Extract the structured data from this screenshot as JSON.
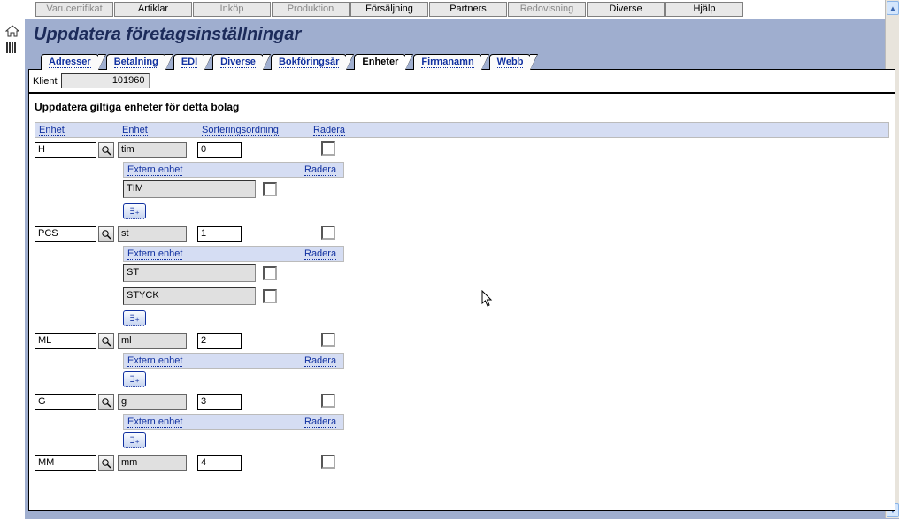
{
  "topMenu": [
    {
      "label": "Varucertifikat",
      "disabled": true
    },
    {
      "label": "Artiklar",
      "disabled": false
    },
    {
      "label": "Inköp",
      "disabled": true
    },
    {
      "label": "Produktion",
      "disabled": true
    },
    {
      "label": "Försäljning",
      "disabled": false
    },
    {
      "label": "Partners",
      "disabled": false
    },
    {
      "label": "Redovisning",
      "disabled": true
    },
    {
      "label": "Diverse",
      "disabled": false
    },
    {
      "label": "Hjälp",
      "disabled": false
    }
  ],
  "pageTitle": "Uppdatera företagsinställningar",
  "tabs": [
    {
      "label": "Adresser"
    },
    {
      "label": "Betalning"
    },
    {
      "label": "EDI"
    },
    {
      "label": "Diverse"
    },
    {
      "label": "Bokföringsår"
    },
    {
      "label": "Enheter"
    },
    {
      "label": "Firmanamn"
    },
    {
      "label": "Webb"
    }
  ],
  "activeTab": "Enheter",
  "klientLabel": "Klient",
  "klientValue": "101960",
  "subtitle": "Uppdatera giltiga enheter för detta bolag",
  "headers": {
    "unitCode": "Enhet",
    "unitName": "Enhet",
    "sort": "Sorteringsordning",
    "del": "Radera",
    "extUnit": "Extern enhet",
    "extDel": "Radera"
  },
  "rows": [
    {
      "code": "H",
      "name": "tim",
      "sort": "0",
      "ext": [
        "TIM"
      ]
    },
    {
      "code": "PCS",
      "name": "st",
      "sort": "1",
      "ext": [
        "ST",
        "STYCK"
      ]
    },
    {
      "code": "ML",
      "name": "ml",
      "sort": "2",
      "ext": []
    },
    {
      "code": "G",
      "name": "g",
      "sort": "3",
      "ext": []
    },
    {
      "code": "MM",
      "name": "mm",
      "sort": "4",
      "ext": []
    }
  ]
}
